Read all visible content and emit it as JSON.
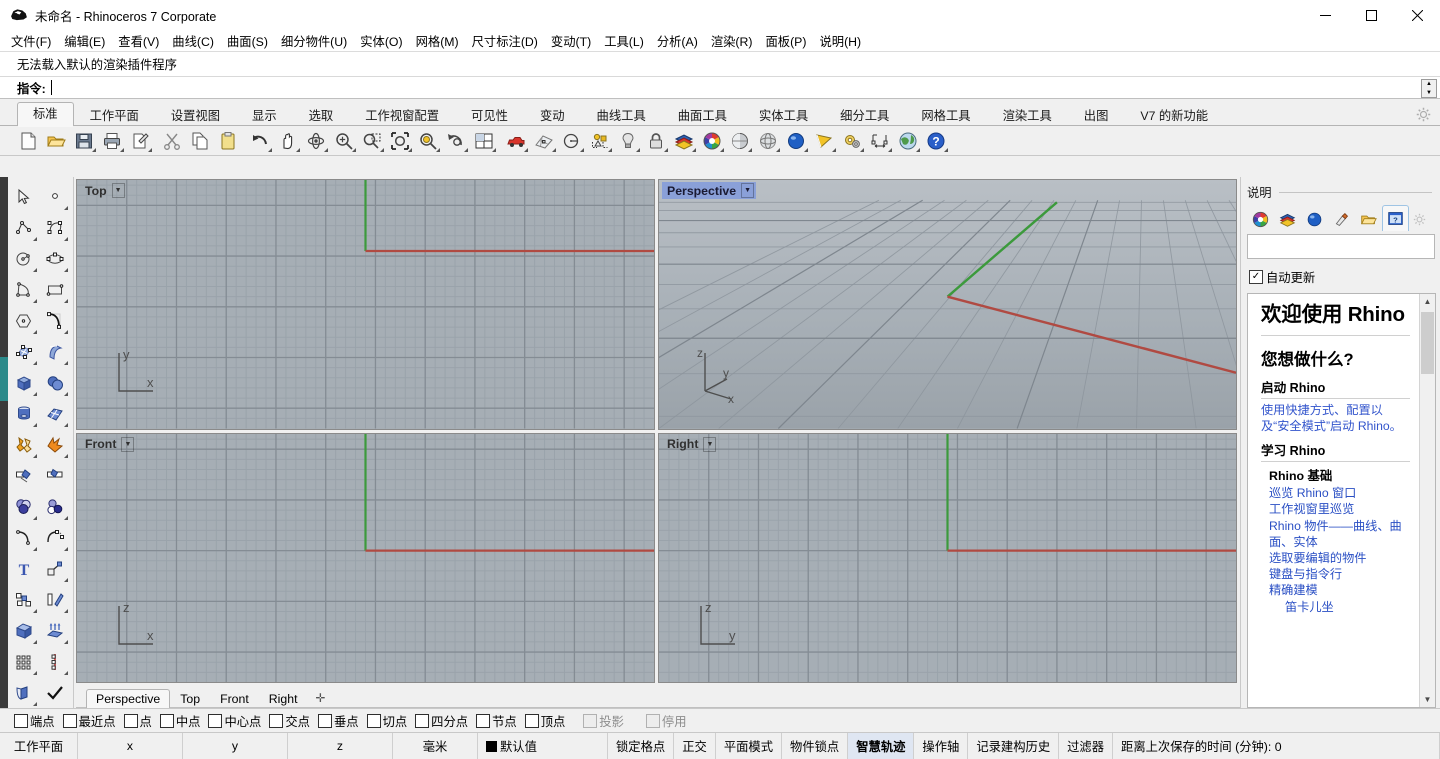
{
  "window": {
    "title": "未命名 - Rhinoceros 7 Corporate",
    "app_icon": "rhino-logo-icon",
    "minimize": "–",
    "maximize": "☐",
    "close": "✕"
  },
  "menubar": [
    {
      "label": "文件(F)",
      "name": "menu-file"
    },
    {
      "label": "编辑(E)",
      "name": "menu-edit"
    },
    {
      "label": "查看(V)",
      "name": "menu-view"
    },
    {
      "label": "曲线(C)",
      "name": "menu-curve"
    },
    {
      "label": "曲面(S)",
      "name": "menu-surface"
    },
    {
      "label": "细分物件(U)",
      "name": "menu-subd"
    },
    {
      "label": "实体(O)",
      "name": "menu-solid"
    },
    {
      "label": "网格(M)",
      "name": "menu-mesh"
    },
    {
      "label": "尺寸标注(D)",
      "name": "menu-dimension"
    },
    {
      "label": "变动(T)",
      "name": "menu-transform"
    },
    {
      "label": "工具(L)",
      "name": "menu-tools"
    },
    {
      "label": "分析(A)",
      "name": "menu-analyze"
    },
    {
      "label": "渲染(R)",
      "name": "menu-render"
    },
    {
      "label": "面板(P)",
      "name": "menu-panels"
    },
    {
      "label": "说明(H)",
      "name": "menu-help"
    }
  ],
  "command": {
    "history": "无法载入默认的渲染插件程序",
    "prompt": "指令:",
    "value": "",
    "placeholder": ""
  },
  "tabs": {
    "active_index": 0,
    "items": [
      "标准",
      "工作平面",
      "设置视图",
      "显示",
      "选取",
      "工作视窗配置",
      "可见性",
      "变动",
      "曲线工具",
      "曲面工具",
      "实体工具",
      "细分工具",
      "网格工具",
      "渲染工具",
      "出图",
      "V7 的新功能"
    ],
    "gear_icon": "gear-icon"
  },
  "toolbar": {
    "buttons": [
      {
        "name": "new-file-button",
        "icon": "new-document-icon",
        "flyout": false
      },
      {
        "name": "open-file-button",
        "icon": "open-folder-icon",
        "flyout": false
      },
      {
        "name": "save-file-button",
        "icon": "save-disk-icon",
        "flyout": true
      },
      {
        "name": "print-button",
        "icon": "printer-icon",
        "flyout": true
      },
      {
        "name": "properties-button",
        "icon": "page-properties-icon",
        "flyout": true
      },
      {
        "name": "cut-button",
        "icon": "scissors-icon",
        "flyout": false
      },
      {
        "name": "copy-button",
        "icon": "copy-pages-icon",
        "flyout": false
      },
      {
        "name": "paste-button",
        "icon": "clipboard-icon",
        "flyout": false
      },
      {
        "name": "undo-button",
        "icon": "undo-arrow-icon",
        "flyout": true
      },
      {
        "name": "pan-button",
        "icon": "hand-pan-icon",
        "flyout": true
      },
      {
        "name": "rotate-view-button",
        "icon": "rotate-view-icon",
        "flyout": true
      },
      {
        "name": "zoom-in-button",
        "icon": "zoom-plus-icon",
        "flyout": true
      },
      {
        "name": "zoom-window-button",
        "icon": "zoom-window-icon",
        "flyout": true
      },
      {
        "name": "zoom-extents-button",
        "icon": "zoom-extents-icon",
        "flyout": true
      },
      {
        "name": "zoom-selected-button",
        "icon": "zoom-selected-icon",
        "flyout": true
      },
      {
        "name": "undo-view-button",
        "icon": "undo-view-icon",
        "flyout": true
      },
      {
        "name": "viewport-layout-button",
        "icon": "viewport-grid-icon",
        "flyout": true
      },
      {
        "name": "render-button",
        "icon": "red-car-icon",
        "flyout": true
      },
      {
        "name": "render-preview-button",
        "icon": "render-mesh-icon",
        "flyout": true
      },
      {
        "name": "circle-button",
        "icon": "circle-radius-icon",
        "flyout": true
      },
      {
        "name": "select-objects-button",
        "icon": "select-objects-icon",
        "flyout": true
      },
      {
        "name": "light-button",
        "icon": "lightbulb-icon",
        "flyout": true
      },
      {
        "name": "lock-button",
        "icon": "padlock-icon",
        "flyout": true
      },
      {
        "name": "layers-button",
        "icon": "layers-icon",
        "flyout": true
      },
      {
        "name": "color-wheel-button",
        "icon": "color-wheel-icon",
        "flyout": true
      },
      {
        "name": "shaded-view-button",
        "icon": "shaded-sphere-icon",
        "flyout": true
      },
      {
        "name": "ghosted-view-button",
        "icon": "ghosted-sphere-icon",
        "flyout": true
      },
      {
        "name": "rendered-view-button",
        "icon": "blue-sphere-icon",
        "flyout": true
      },
      {
        "name": "gumball-button",
        "icon": "gumball-cone-icon",
        "flyout": true
      },
      {
        "name": "options-button",
        "icon": "gears-options-icon",
        "flyout": true
      },
      {
        "name": "dimension-button",
        "icon": "dimension-icon",
        "flyout": true
      },
      {
        "name": "earth-button",
        "icon": "globe-earth-icon",
        "flyout": true
      },
      {
        "name": "help-button",
        "icon": "blue-question-icon",
        "flyout": true
      }
    ]
  },
  "left_toolbar": {
    "buttons": [
      {
        "name": "select-arrow-button",
        "icon": "arrow-cursor-icon",
        "flyout": false
      },
      {
        "name": "point-button",
        "icon": "point-dot-icon",
        "flyout": true
      },
      {
        "name": "polyline-button",
        "icon": "polyline-icon",
        "flyout": true
      },
      {
        "name": "control-point-curve-button",
        "icon": "control-curve-icon",
        "flyout": true
      },
      {
        "name": "circle-button",
        "icon": "circle-center-icon",
        "flyout": true
      },
      {
        "name": "ellipse-button",
        "icon": "ellipse-icon",
        "flyout": true
      },
      {
        "name": "arc-button",
        "icon": "arc-triangle-icon",
        "flyout": true
      },
      {
        "name": "rectangle-button",
        "icon": "rectangle-icon",
        "flyout": true
      },
      {
        "name": "polygon-button",
        "icon": "hexagon-icon",
        "flyout": true
      },
      {
        "name": "curve-fillet-button",
        "icon": "fillet-curve-icon",
        "flyout": true
      },
      {
        "name": "surface-points-button",
        "icon": "surface-points-icon",
        "flyout": true
      },
      {
        "name": "extrude-surface-button",
        "icon": "extrude-surface-icon",
        "flyout": true
      },
      {
        "name": "box-button",
        "icon": "blue-box-icon",
        "flyout": true
      },
      {
        "name": "sphere-button",
        "icon": "two-spheres-icon",
        "flyout": true
      },
      {
        "name": "cylinder-button",
        "icon": "cylinder-icon",
        "flyout": true
      },
      {
        "name": "subd-box-button",
        "icon": "subd-surface-icon",
        "flyout": true
      },
      {
        "name": "boolean-union-button",
        "icon": "boolean-union-icon",
        "flyout": true
      },
      {
        "name": "explode-button",
        "icon": "explode-star-icon",
        "flyout": true
      },
      {
        "name": "trim-button",
        "icon": "trim-icon",
        "flyout": true
      },
      {
        "name": "split-button",
        "icon": "split-icon",
        "flyout": true
      },
      {
        "name": "boolean-difference-button",
        "icon": "three-circles-icon",
        "flyout": true
      },
      {
        "name": "boolean-intersect-button",
        "icon": "circles-pair-icon",
        "flyout": true
      },
      {
        "name": "offset-curve-button",
        "icon": "offset-curve-icon",
        "flyout": true
      },
      {
        "name": "blend-curve-button",
        "icon": "blend-curve-icon",
        "flyout": true
      },
      {
        "name": "text-button",
        "icon": "text-t-icon",
        "flyout": true
      },
      {
        "name": "scale-button",
        "icon": "scale-arrow-icon",
        "flyout": true
      },
      {
        "name": "copy-objects-button",
        "icon": "copy-squares-icon",
        "flyout": true
      },
      {
        "name": "mirror-button",
        "icon": "mirror-icon",
        "flyout": true
      },
      {
        "name": "cap-button",
        "icon": "cap-box-icon",
        "flyout": true
      },
      {
        "name": "extrude-curve-button",
        "icon": "extrude-up-icon",
        "flyout": true
      },
      {
        "name": "array-button",
        "icon": "array-grid-icon",
        "flyout": true
      },
      {
        "name": "array-along-curve-button",
        "icon": "array-curve-icon",
        "flyout": true
      },
      {
        "name": "unroll-button",
        "icon": "unroll-icon",
        "flyout": true
      },
      {
        "name": "check-button",
        "icon": "checkmark-icon",
        "flyout": false
      },
      {
        "name": "mesh-from-surface-button",
        "icon": "mesh-cone-icon",
        "flyout": true
      },
      {
        "name": "render-material-button",
        "icon": "material-diamond-icon",
        "flyout": true
      }
    ]
  },
  "viewports": [
    {
      "name": "viewport-top",
      "label": "Top",
      "active": false,
      "axes": [
        "y",
        "x"
      ]
    },
    {
      "name": "viewport-perspective",
      "label": "Perspective",
      "active": true,
      "axes": [
        "z",
        "y",
        "x"
      ]
    },
    {
      "name": "viewport-front",
      "label": "Front",
      "active": false,
      "axes": [
        "z",
        "x"
      ]
    },
    {
      "name": "viewport-right",
      "label": "Right",
      "active": false,
      "axes": [
        "z",
        "y"
      ]
    }
  ],
  "viewport_tabs": {
    "active_index": 0,
    "items": [
      "Perspective",
      "Top",
      "Front",
      "Right"
    ],
    "add_label": "✛"
  },
  "help_panel": {
    "title": "说明",
    "tabs": [
      {
        "name": "rp-tab-color-wheel",
        "icon": "color-wheel-icon",
        "active": false
      },
      {
        "name": "rp-tab-layers",
        "icon": "layers-icon",
        "active": false
      },
      {
        "name": "rp-tab-render",
        "icon": "blue-sphere-icon",
        "active": false
      },
      {
        "name": "rp-tab-material",
        "icon": "paint-tube-icon",
        "active": false
      },
      {
        "name": "rp-tab-files",
        "icon": "open-folder-icon",
        "active": false
      },
      {
        "name": "rp-tab-help",
        "icon": "help-window-icon",
        "active": true
      }
    ],
    "gear_icon": "gear-icon",
    "search_value": "",
    "search_placeholder": "",
    "auto_update_label": "自动更新",
    "auto_update_checked": true,
    "doc": {
      "h1": "欢迎使用 Rhino",
      "h2": "您想做什么?",
      "section1_title": "启动 Rhino",
      "section1_text": "使用快捷方式、配置以及“安全模式”启动 Rhino。",
      "section2_title": "学习 Rhino",
      "group_title": "Rhino 基础",
      "links": [
        "巡览 Rhino 窗口",
        "工作视窗里巡览",
        "Rhino 物件——曲线、曲面、实体",
        "选取要编辑的物件",
        "键盘与指令行",
        "精确建模"
      ],
      "sub_link": "笛卡儿坐"
    }
  },
  "osnap": {
    "items": [
      {
        "label": "端点",
        "checked": false,
        "disabled": false
      },
      {
        "label": "最近点",
        "checked": false,
        "disabled": false
      },
      {
        "label": "点",
        "checked": false,
        "disabled": false
      },
      {
        "label": "中点",
        "checked": false,
        "disabled": false
      },
      {
        "label": "中心点",
        "checked": false,
        "disabled": false
      },
      {
        "label": "交点",
        "checked": false,
        "disabled": false
      },
      {
        "label": "垂点",
        "checked": false,
        "disabled": false
      },
      {
        "label": "切点",
        "checked": false,
        "disabled": false
      },
      {
        "label": "四分点",
        "checked": false,
        "disabled": false
      },
      {
        "label": "节点",
        "checked": false,
        "disabled": false
      },
      {
        "label": "顶点",
        "checked": false,
        "disabled": false
      },
      {
        "label": "投影",
        "checked": false,
        "disabled": true
      },
      {
        "label": "停用",
        "checked": false,
        "disabled": true
      }
    ]
  },
  "statusbar": {
    "cplane_label": "工作平面",
    "x_label": "x",
    "y_label": "y",
    "z_label": "z",
    "units": "毫米",
    "layer": "默认值",
    "layer_color": "#000000",
    "toggles": [
      {
        "label": "锁定格点",
        "on": false
      },
      {
        "label": "正交",
        "on": false
      },
      {
        "label": "平面模式",
        "on": false
      },
      {
        "label": "物件锁点",
        "on": false
      },
      {
        "label": "智慧轨迹",
        "on": true
      },
      {
        "label": "操作轴",
        "on": false
      },
      {
        "label": "记录建构历史",
        "on": false
      },
      {
        "label": "过滤器",
        "on": false
      }
    ],
    "save_timer": "距离上次保存的时间 (分钟): 0"
  }
}
